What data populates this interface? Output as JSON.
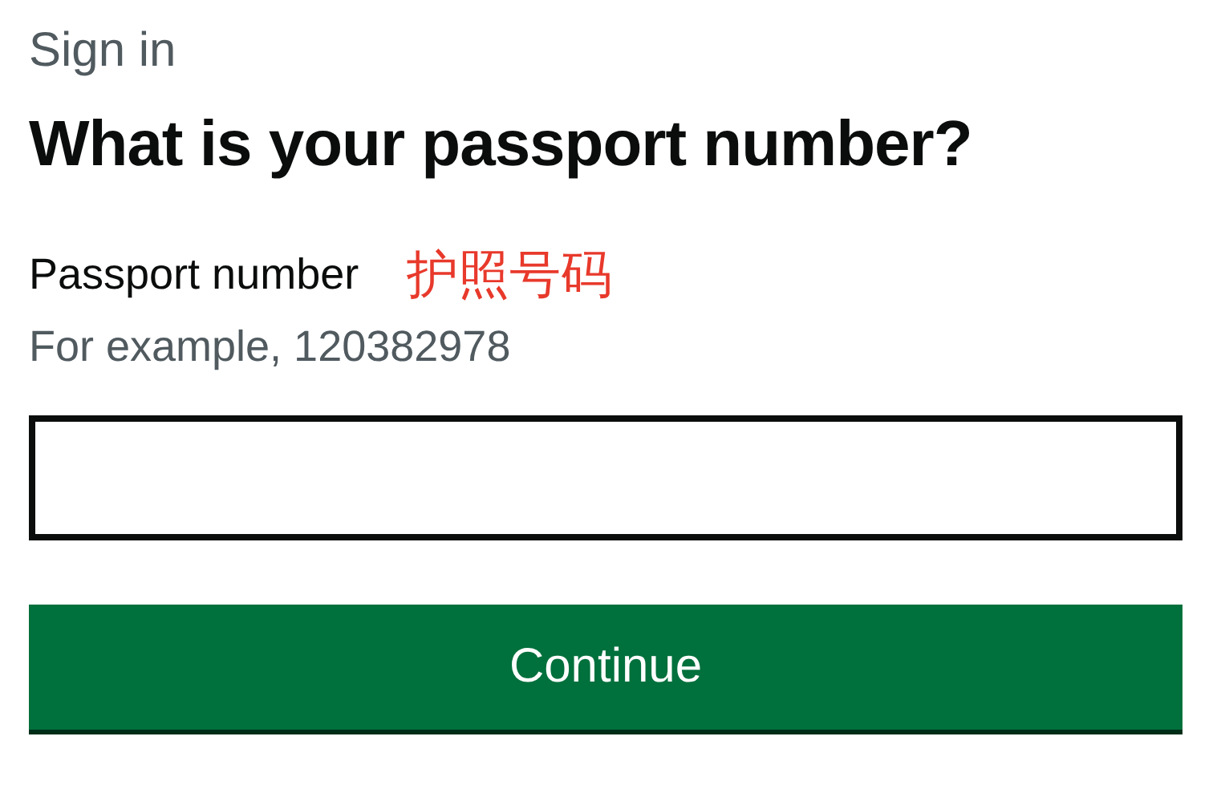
{
  "caption": "Sign in",
  "heading": "What is your passport number?",
  "field": {
    "label": "Passport number",
    "annotation": "护照号码",
    "hint": "For example, 120382978"
  },
  "button": {
    "label": "Continue"
  }
}
